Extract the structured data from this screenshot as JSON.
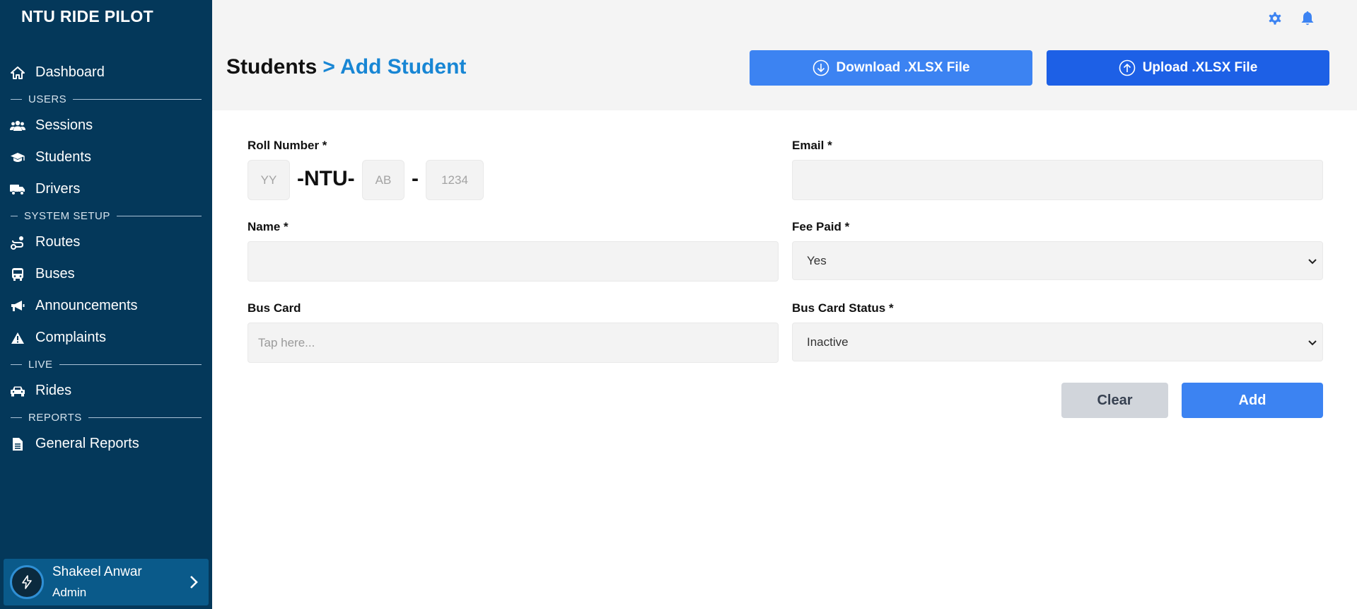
{
  "app": {
    "title": "NTU RIDE PILOT"
  },
  "sidebar": {
    "items": [
      {
        "type": "item",
        "label": "Dashboard",
        "icon": "home-icon"
      },
      {
        "type": "section",
        "label": "USERS"
      },
      {
        "type": "item",
        "label": "Sessions",
        "icon": "users-icon"
      },
      {
        "type": "item",
        "label": "Students",
        "icon": "graduation-cap-icon"
      },
      {
        "type": "item",
        "label": "Drivers",
        "icon": "truck-icon"
      },
      {
        "type": "section",
        "label": "SYSTEM SETUP"
      },
      {
        "type": "item",
        "label": "Routes",
        "icon": "route-icon"
      },
      {
        "type": "item",
        "label": "Buses",
        "icon": "bus-icon"
      },
      {
        "type": "item",
        "label": "Announcements",
        "icon": "megaphone-icon"
      },
      {
        "type": "item",
        "label": "Complaints",
        "icon": "warning-icon"
      },
      {
        "type": "section",
        "label": "LIVE"
      },
      {
        "type": "item",
        "label": "Rides",
        "icon": "car-icon"
      },
      {
        "type": "section",
        "label": "REPORTS"
      },
      {
        "type": "item",
        "label": "General Reports",
        "icon": "file-icon"
      }
    ],
    "user": {
      "name": "Shakeel Anwar",
      "role": "Admin"
    }
  },
  "header": {
    "breadcrumb_root": "Students",
    "breadcrumb_current": "> Add Student",
    "download_label": "Download .XLSX File",
    "upload_label": "Upload .XLSX File"
  },
  "form": {
    "roll_number": {
      "label": "Roll Number *",
      "year_placeholder": "YY",
      "sep1": "-NTU-",
      "dept_placeholder": "AB",
      "sep2": "-",
      "num_placeholder": "1234"
    },
    "email": {
      "label": "Email *",
      "value": ""
    },
    "name": {
      "label": "Name *",
      "value": ""
    },
    "fee_paid": {
      "label": "Fee Paid *",
      "value": "Yes"
    },
    "bus_card": {
      "label": "Bus Card",
      "placeholder": "Tap here..."
    },
    "bus_card_status": {
      "label": "Bus Card Status *",
      "value": "Inactive"
    },
    "clear_label": "Clear",
    "add_label": "Add"
  },
  "colors": {
    "sidebar_bg": "#04385a",
    "accent": "#1886d4",
    "primary_button": "#3c83f2",
    "upload_button": "#1d60e6"
  }
}
